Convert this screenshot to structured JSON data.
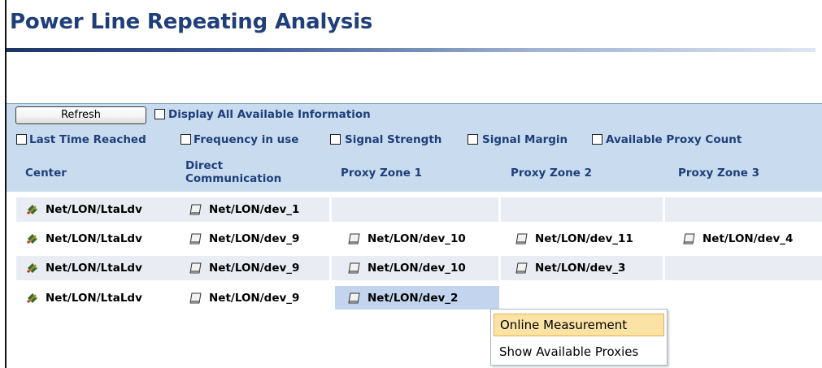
{
  "page": {
    "title": "Power Line Repeating Analysis"
  },
  "toolbar": {
    "refresh_label": "Refresh",
    "display_all_label": "Display All Available Information",
    "options": [
      {
        "label": "Last Time Reached",
        "checked": false
      },
      {
        "label": "Frequency in use",
        "checked": false
      },
      {
        "label": "Signal Strength",
        "checked": false
      },
      {
        "label": "Signal Margin",
        "checked": false
      },
      {
        "label": "Available Proxy Count",
        "checked": false
      }
    ],
    "display_all_checked": false
  },
  "table": {
    "headers": [
      {
        "line1": "Center",
        "line2": ""
      },
      {
        "line1": "Direct",
        "line2": "Communication"
      },
      {
        "line1": "Proxy Zone 1",
        "line2": ""
      },
      {
        "line1": "Proxy Zone 2",
        "line2": ""
      },
      {
        "line1": "Proxy Zone 3",
        "line2": ""
      }
    ],
    "rows": [
      {
        "center": {
          "label": "Net/LON/LtaLdv",
          "icon": "center-node-icon"
        },
        "cells": [
          {
            "label": "Net/LON/dev_1",
            "icon": "device-icon"
          }
        ]
      },
      {
        "center": {
          "label": "Net/LON/LtaLdv",
          "icon": "center-node-icon"
        },
        "cells": [
          {
            "label": "Net/LON/dev_9",
            "icon": "device-icon"
          },
          {
            "label": "Net/LON/dev_10",
            "icon": "device-icon"
          },
          {
            "label": "Net/LON/dev_11",
            "icon": "device-icon"
          },
          {
            "label": "Net/LON/dev_4",
            "icon": "device-icon"
          }
        ]
      },
      {
        "center": {
          "label": "Net/LON/LtaLdv",
          "icon": "center-node-icon"
        },
        "cells": [
          {
            "label": "Net/LON/dev_9",
            "icon": "device-icon"
          },
          {
            "label": "Net/LON/dev_10",
            "icon": "device-icon"
          },
          {
            "label": "Net/LON/dev_3",
            "icon": "device-icon"
          }
        ]
      },
      {
        "center": {
          "label": "Net/LON/LtaLdv",
          "icon": "center-node-icon"
        },
        "cells": [
          {
            "label": "Net/LON/dev_9",
            "icon": "device-icon"
          },
          {
            "label": "Net/LON/dev_2",
            "icon": "device-icon",
            "selected": true
          }
        ]
      }
    ]
  },
  "context_menu": {
    "items": [
      {
        "label": "Online Measurement",
        "highlighted": true
      },
      {
        "label": "Show Available Proxies",
        "highlighted": false
      }
    ]
  },
  "colors": {
    "heading": "#1f3f7a",
    "panel_bg": "#c9dcef",
    "row_alt_bg": "#e9edf3",
    "selected_cell_bg": "#c2d4ee",
    "menu_highlight": "#fbe3a6"
  }
}
